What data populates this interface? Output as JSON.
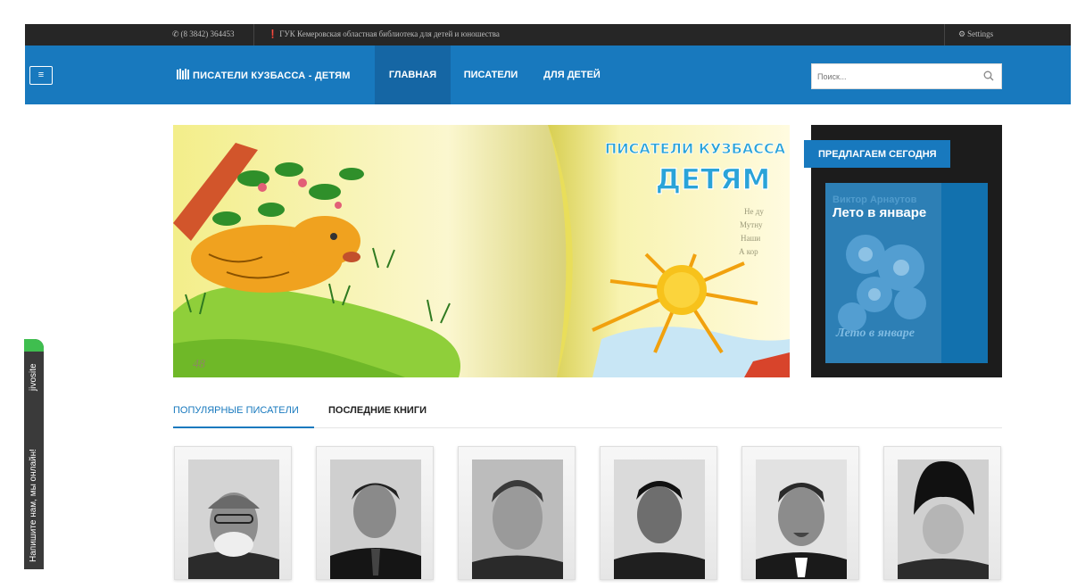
{
  "topbar": {
    "phone": "(8 3842) 364453",
    "organization": "ГУК Кемеровская областная библиотека для детей и юношества",
    "settings": "Settings"
  },
  "navbar": {
    "brand": "ПИСАТЕЛИ КУЗБАССА - ДЕТЯМ",
    "items": [
      {
        "label": "ГЛАВНАЯ",
        "active": true
      },
      {
        "label": "ПИСАТЕЛИ",
        "active": false
      },
      {
        "label": "ДЛЯ ДЕТЕЙ",
        "active": false
      }
    ],
    "search_placeholder": "Поиск..."
  },
  "hero": {
    "title_line1": "ПИСАТЕЛИ КУЗБАССА",
    "title_line2": "ДЕТЯМ",
    "page_number": "48"
  },
  "today": {
    "tag": "ПРЕДЛАГАЕМ СЕГОДНЯ",
    "book_author": "Виктор Арнаутов",
    "book_title": "Лето в январе",
    "cover_text": "Лето в январе"
  },
  "tabs": [
    {
      "label": "ПОПУЛЯРНЫЕ ПИСАТЕЛИ",
      "active": true
    },
    {
      "label": "ПОСЛЕДНИЕ КНИГИ",
      "active": false
    }
  ],
  "jivosite": {
    "brand": "jivosite",
    "message": "Напишите нам, мы онлайн!"
  },
  "colors": {
    "primary": "#1879be",
    "primary_dark": "#1566a4",
    "topbar": "#262626",
    "widget_bg": "#1c1c1c",
    "jivo_green": "#3fbe4f"
  },
  "icons": [
    "phone-icon",
    "info-icon",
    "settings-icon",
    "menu-icon",
    "library-logo-icon",
    "search-icon"
  ]
}
